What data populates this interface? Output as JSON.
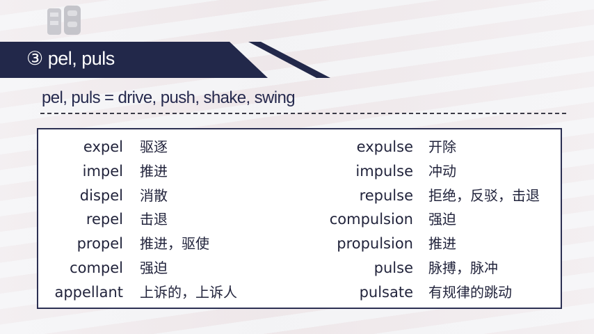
{
  "header": {
    "title": "③ pel, puls",
    "banner_color": "#22284a"
  },
  "subtitle": "pel, puls = drive, push, shake, swing",
  "vocab": {
    "left": [
      {
        "term": "expel",
        "meaning": "驱逐"
      },
      {
        "term": "impel",
        "meaning": "推进"
      },
      {
        "term": "dispel",
        "meaning": "消散"
      },
      {
        "term": "repel",
        "meaning": "击退"
      },
      {
        "term": "propel",
        "meaning": "推进，驱使"
      },
      {
        "term": "compel",
        "meaning": "强迫"
      },
      {
        "term": "appellant",
        "meaning": "上诉的，上诉人"
      }
    ],
    "right": [
      {
        "term": "expulse",
        "meaning": "开除"
      },
      {
        "term": "impulse",
        "meaning": "冲动"
      },
      {
        "term": "repulse",
        "meaning": "拒绝，反驳，击退"
      },
      {
        "term": "compulsion",
        "meaning": "强迫"
      },
      {
        "term": "propulsion",
        "meaning": "推进"
      },
      {
        "term": "pulse",
        "meaning": "脉搏，脉冲"
      },
      {
        "term": "pulsate",
        "meaning": "有规律的跳动"
      }
    ]
  }
}
